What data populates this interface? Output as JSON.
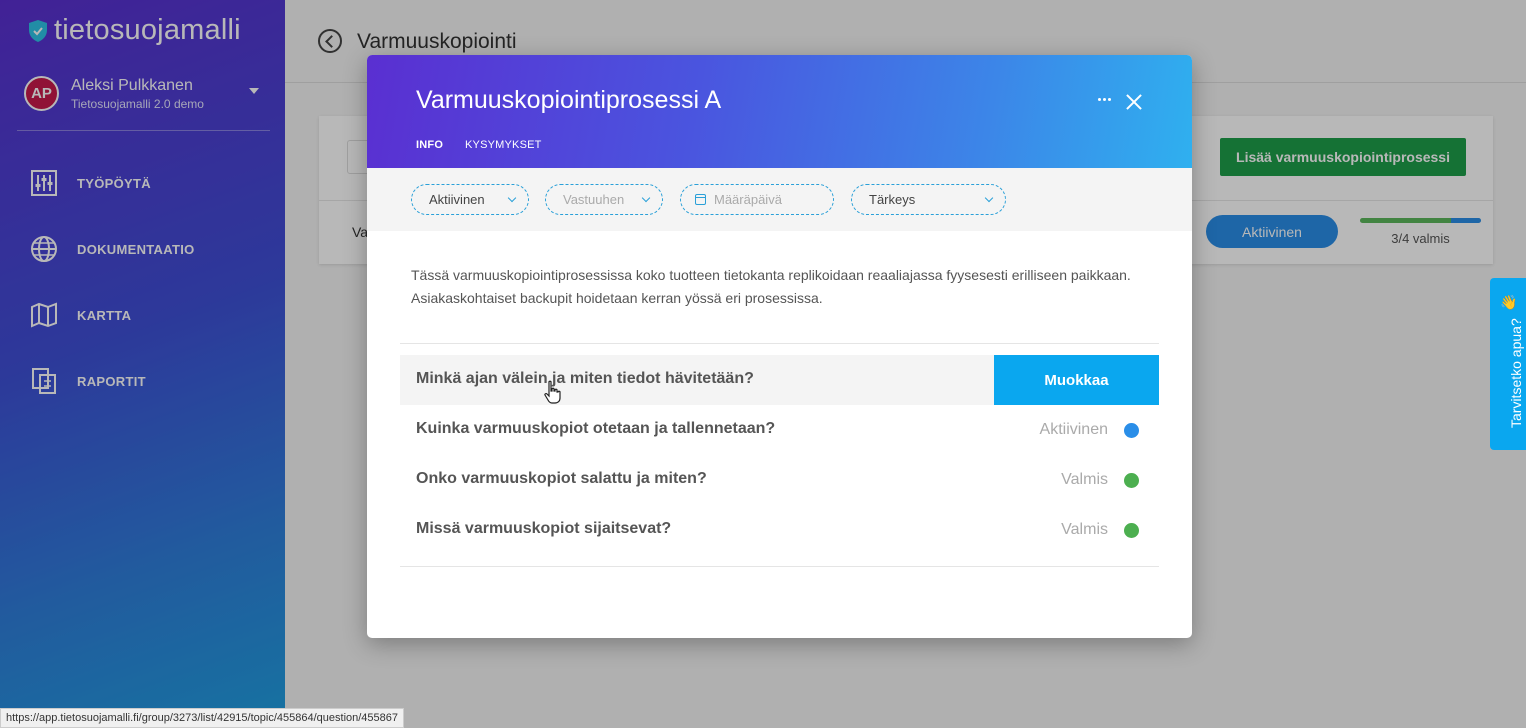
{
  "app": {
    "logo_text": "tietosuojamalli",
    "user": {
      "initials": "AP",
      "name": "Aleksi Pulkkanen",
      "org": "Tietosuojamalli 2.0 demo"
    },
    "nav": [
      {
        "label": "TYÖPÖYTÄ",
        "icon": "sliders-icon"
      },
      {
        "label": "DOKUMENTAATIO",
        "icon": "globe-icon"
      },
      {
        "label": "KARTTA",
        "icon": "map-icon"
      },
      {
        "label": "RAPORTIT",
        "icon": "reports-icon"
      }
    ]
  },
  "page": {
    "title": "Varmuuskopiointi",
    "add_button": "Lisää varmuuskopiointiprosessi",
    "row": {
      "name": "Va",
      "status": "Aktiivinen",
      "progress_label": "3/4 valmis",
      "progress": 0.75
    }
  },
  "help": {
    "label": "Tarvitsetko apua?",
    "emoji": "👋"
  },
  "modal": {
    "title": "Varmuuskopiointiprosessi A",
    "tabs": {
      "info": "INFO",
      "questions": "KYSYMYKSET"
    },
    "filters": {
      "status": "Aktiivinen",
      "owner_placeholder": "Vastuuhen",
      "due_placeholder": "Määräpäivä",
      "priority": "Tärkeys"
    },
    "description": "Tässä varmuuskopiointiprosessissa koko tuotteen tietokanta replikoidaan reaaliajassa fyysesesti erilliseen paikkaan. Asiakaskohtaiset backupit hoidetaan kerran yössä eri prosessissa.",
    "edit_label": "Muokkaa",
    "questions": [
      {
        "text": "Minkä ajan välein ja miten tiedot hävitetään?",
        "status": "",
        "color": ""
      },
      {
        "text": "Kuinka varmuuskopiot otetaan ja tallennetaan?",
        "status": "Aktiivinen",
        "color": "#2a8ee8"
      },
      {
        "text": "Onko varmuuskopiot salattu ja miten?",
        "status": "Valmis",
        "color": "#4caf50"
      },
      {
        "text": "Missä varmuuskopiot sijaitsevat?",
        "status": "Valmis",
        "color": "#4caf50"
      }
    ]
  },
  "status_bar": {
    "url": "https://app.tietosuojamalli.fi/group/3273/list/42915/topic/455864/question/455867"
  }
}
